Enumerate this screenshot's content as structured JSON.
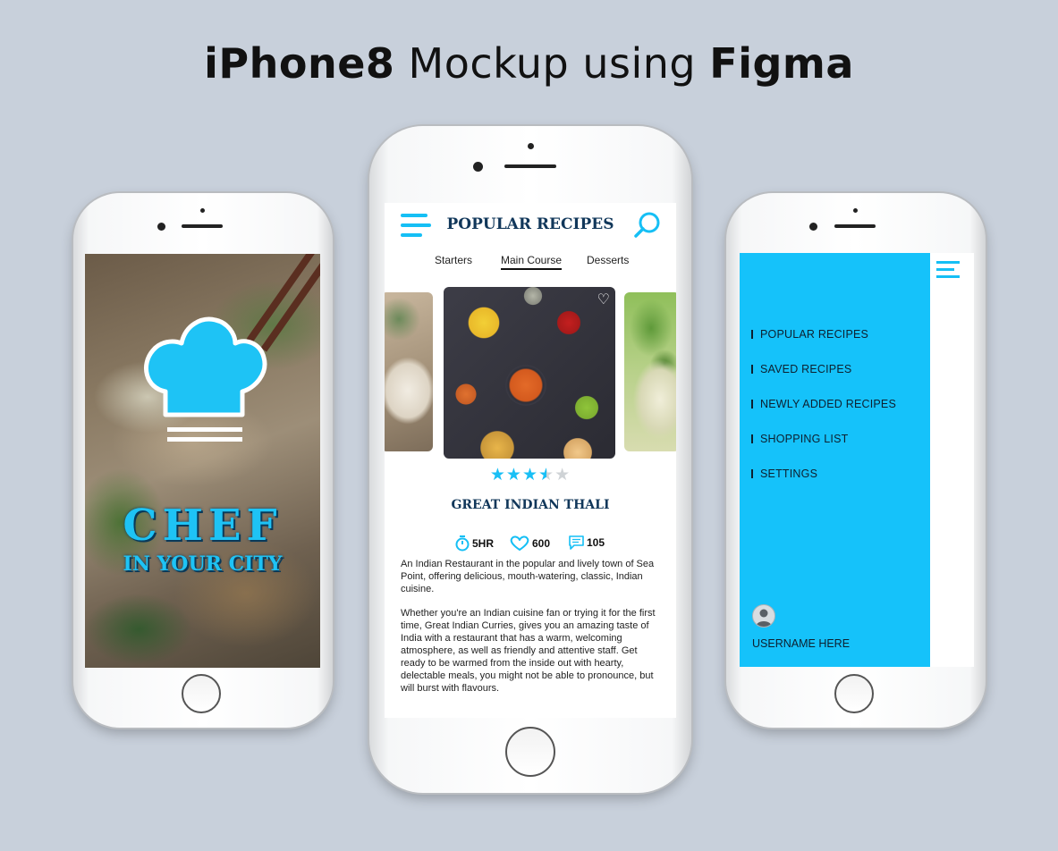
{
  "headline": {
    "part1": "iPhone8",
    "part2": " Mockup using ",
    "part3": "Figma"
  },
  "splash": {
    "title_line1": "CHEF",
    "title_line2": "IN YOUR CITY"
  },
  "recipes": {
    "header_title": "POPULAR RECIPES",
    "tabs": [
      {
        "label": "Starters",
        "active": false
      },
      {
        "label": "Main Course",
        "active": true
      },
      {
        "label": "Desserts",
        "active": false
      }
    ],
    "rating": 3.5,
    "rating_max": 5,
    "dish_name": "GREAT INDIAN THALI",
    "stats": {
      "time": "5HR",
      "likes": "600",
      "comments": "105"
    },
    "description_p1": "An Indian Restaurant in the popular and lively town of Sea Point, offering delicious, mouth-watering, classic, Indian cuisine.",
    "description_p2": "Whether you're an Indian cuisine fan or trying it for the first time, Great Indian Curries, gives you an amazing taste of India with a restaurant that has a warm, welcoming atmosphere, as well as friendly and attentive staff. Get ready to be warmed from the inside out with hearty, delectable meals, you might not be able to pronounce, but will burst with flavours."
  },
  "menu": {
    "items": [
      "POPULAR RECIPES",
      "SAVED RECIPES",
      "NEWLY ADDED RECIPES",
      "SHOPPING LIST",
      "SETTINGS"
    ],
    "username": "USERNAME HERE"
  },
  "colors": {
    "accent": "#15c2fa",
    "navy": "#11375a",
    "background": "#c8d0db"
  }
}
